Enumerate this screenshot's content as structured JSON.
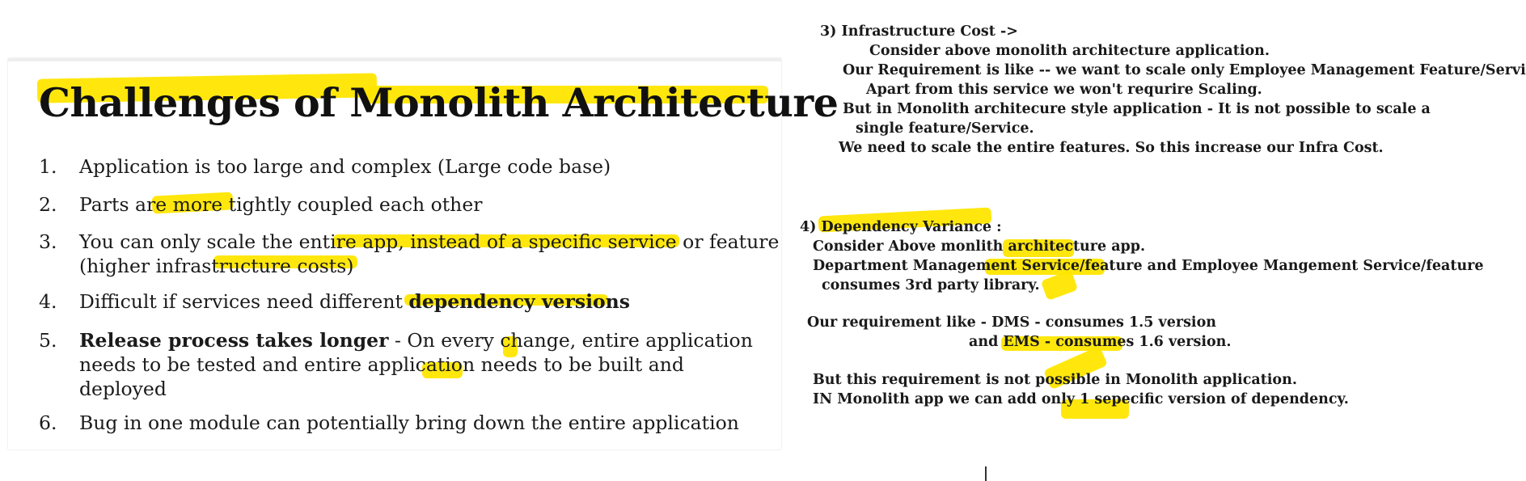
{
  "slide": {
    "title": "Challenges of Monolith Architecture",
    "items": [
      {
        "num": "1.",
        "text": "Application is too large and complex (Large code base)"
      },
      {
        "num": "2.",
        "text": "Parts are more tightly coupled each other"
      },
      {
        "num": "3.",
        "line1": "You can only scale the entire app, instead of a specific service or feature",
        "line2": "(higher  infrastructure costs)"
      },
      {
        "num": "4.",
        "pre": "Difficult if services need different ",
        "bold": "dependency versions"
      },
      {
        "num": "5.",
        "bold": "Release process takes longer",
        "line1_rest": " - On every change, entire application",
        "line2": "needs to be tested and entire application needs to be built and",
        "line3": "deployed"
      },
      {
        "num": "6.",
        "text": "Bug in one module can potentially bring down the entire application"
      }
    ]
  },
  "notes": {
    "infra": [
      "3) Infrastructure Cost ->",
      "Consider above monolith architecture application.",
      "Our Requirement is like  -- we want to scale only Employee Management Feature/Service.",
      "Apart from this service we won't requrire Scaling.",
      "But in Monolith architecure style application - It is not possible to scale a",
      "single feature/Service.",
      "We need to scale the entire features. So this increase our Infra Cost."
    ],
    "dependency": [
      "4) Dependency Variance :",
      "Consider Above monlith architecture app.",
      "Department Management Service/feature and Employee Mangement Service/feature",
      "consumes 3rd party library.",
      "Our requirement like - DMS - consumes 1.5 version",
      "and EMS - consumes 1.6 version.",
      "But this requirement is not possible in Monolith application.",
      "IN Monolith app we can add only 1 sepecific version of dependency."
    ]
  },
  "colors": {
    "highlight": "#ffe600",
    "text": "#1b1b1b"
  }
}
